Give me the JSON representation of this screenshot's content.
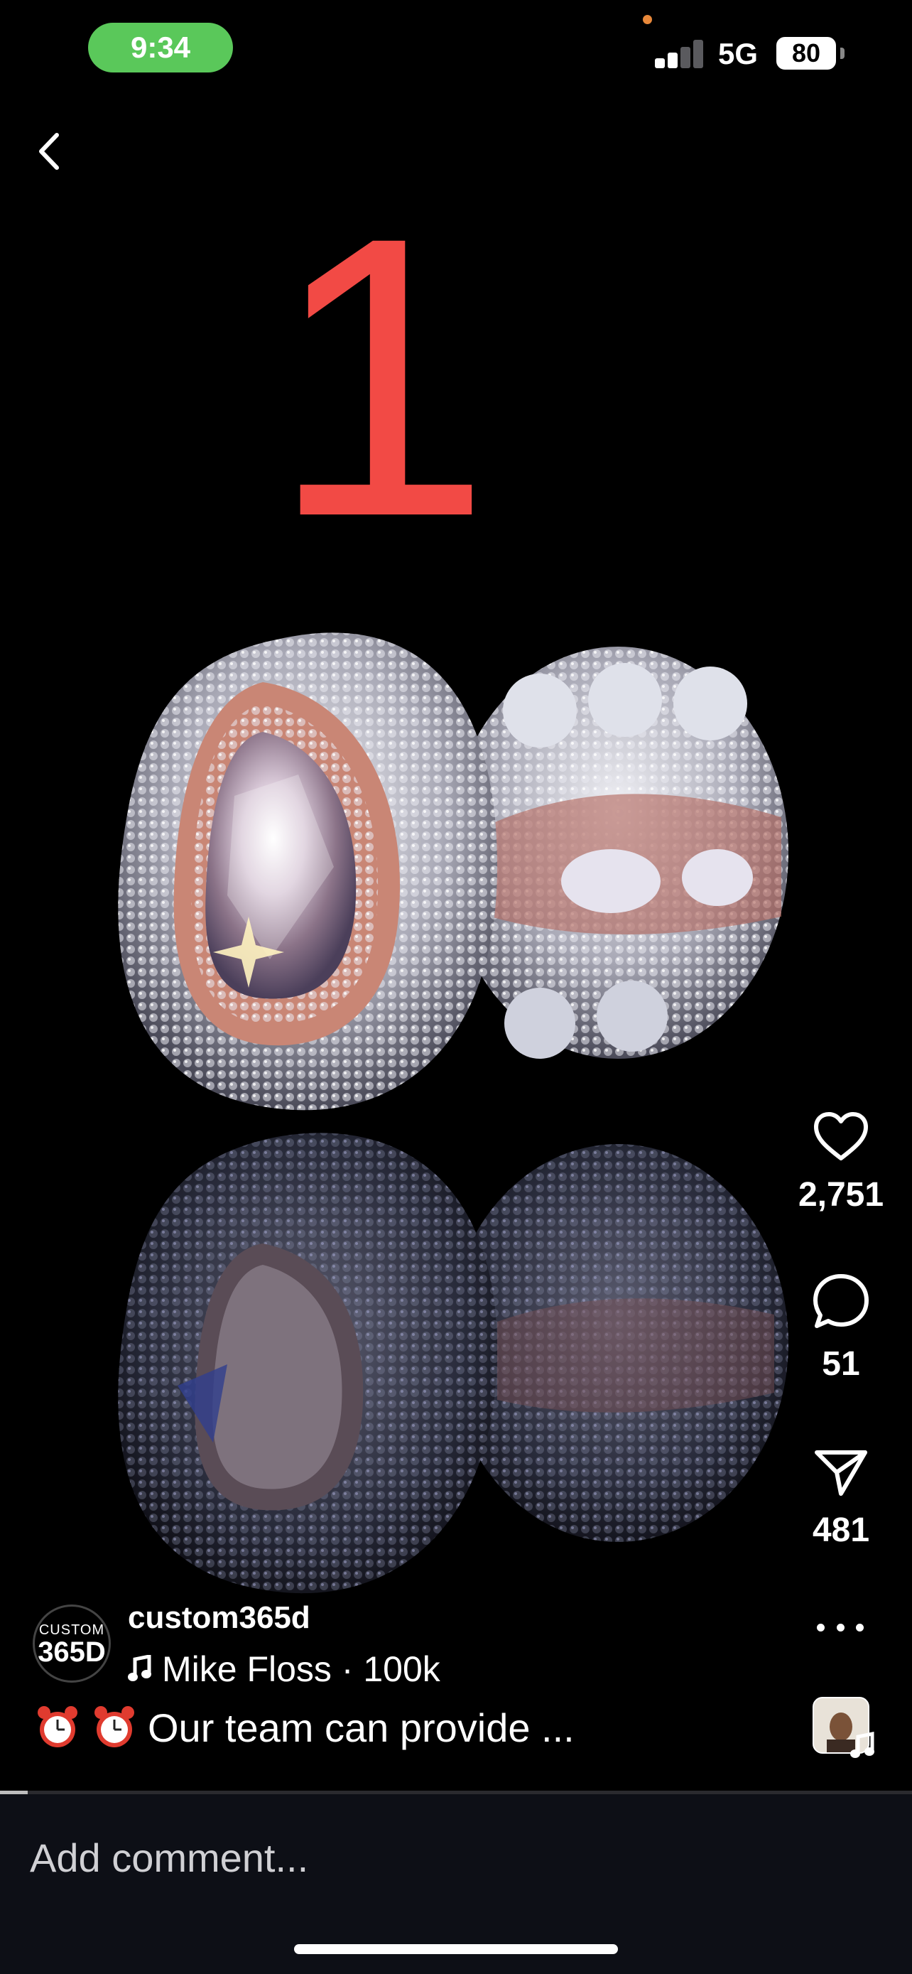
{
  "status_bar": {
    "time": "9:34",
    "network": "5G",
    "battery": "80",
    "signal_bars_active": 2,
    "signal_bars_total": 4
  },
  "header": {
    "back_icon": "chevron-left-icon"
  },
  "media": {
    "overlay_number": "1",
    "overlay_color": "#f24a45",
    "subject": "rose-and-white diamond ring set on black reflective surface"
  },
  "actions": {
    "likes": "2,751",
    "comments": "51",
    "shares": "481"
  },
  "post": {
    "avatar_top": "CUSTOM",
    "avatar_bottom": "365D",
    "username": "custom365d",
    "audio": "Mike Floss · 100k",
    "caption": "Our team can provide ..."
  },
  "progress": {
    "fraction": 0.03
  },
  "comment": {
    "placeholder": "Add comment..."
  },
  "colors": {
    "background": "#000000",
    "time_pill": "#5ac85a",
    "comment_bar": "#0d0f16"
  }
}
